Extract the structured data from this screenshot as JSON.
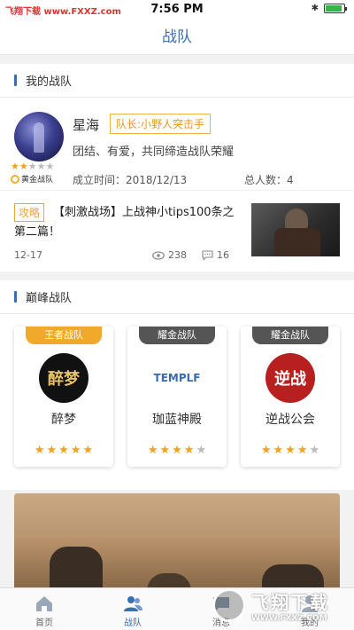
{
  "status_bar": {
    "carrier": "飞翔下载 www.FXXZ.com",
    "time": "7:56 PM",
    "bluetooth": "✱",
    "battery_level": 0.9
  },
  "nav": {
    "title": "战队"
  },
  "my_team": {
    "section_title": "我的战队",
    "name": "星海",
    "captain": "队长:小野人突击手",
    "motto": "团结、有爱，共同缔造战队荣耀",
    "founded": "成立时间：2018/12/13",
    "members": "总人数：4",
    "rating": 2,
    "rank_label": "黄金战队"
  },
  "article": {
    "tag": "攻略",
    "title": "【刺激战场】上战神小tips100条之第二篇！",
    "date": "12-17",
    "views": "238",
    "comments": "16"
  },
  "peak": {
    "section_title": "巅峰战队",
    "teams": [
      {
        "label": "王者战队",
        "label_style": "gold",
        "logo_text": "醉梦",
        "name": "醉梦",
        "rating": 5
      },
      {
        "label": "耀金战队",
        "label_style": "gray",
        "logo_text": "TEMPLF",
        "name": "珈蓝神殿",
        "rating": 4
      },
      {
        "label": "耀金战队",
        "label_style": "gray",
        "logo_text": "逆战",
        "name": "逆战公会",
        "rating": 4
      }
    ]
  },
  "tabs": [
    {
      "label": "首页",
      "icon": "home-icon",
      "active": false
    },
    {
      "label": "战队",
      "icon": "team-icon",
      "active": true
    },
    {
      "label": "消息",
      "icon": "message-icon",
      "active": false
    },
    {
      "label": "我的",
      "icon": "profile-icon",
      "active": false
    }
  ],
  "watermark": {
    "big": "飞翔下载",
    "small": "WWW.FXXZ.COM"
  },
  "colors": {
    "accent": "#3a6fb0",
    "gold": "#f0a92a",
    "star": "#f2a21c"
  }
}
